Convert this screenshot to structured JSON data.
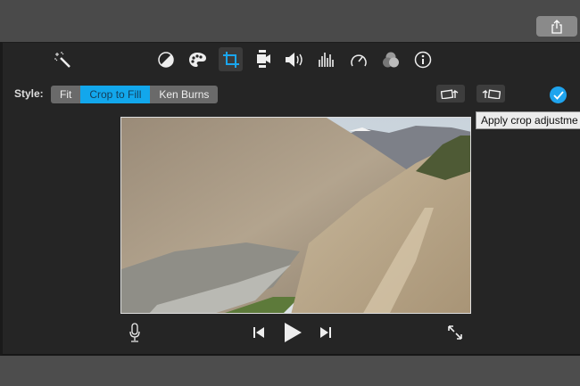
{
  "toolbar": {
    "icons": [
      "magic-wand-icon",
      "color-balance-icon",
      "color-correction-icon",
      "crop-icon",
      "stabilization-icon",
      "volume-icon",
      "equalizer-icon",
      "speed-icon",
      "clip-filter-icon",
      "info-icon"
    ],
    "selected": "crop-icon"
  },
  "style": {
    "label": "Style:",
    "options": [
      "Fit",
      "Crop to Fill",
      "Ken Burns"
    ],
    "selected": "Crop to Fill"
  },
  "tooltip": "Apply crop adjustme",
  "colors": {
    "accent": "#12a7ec",
    "panel": "#252525"
  }
}
